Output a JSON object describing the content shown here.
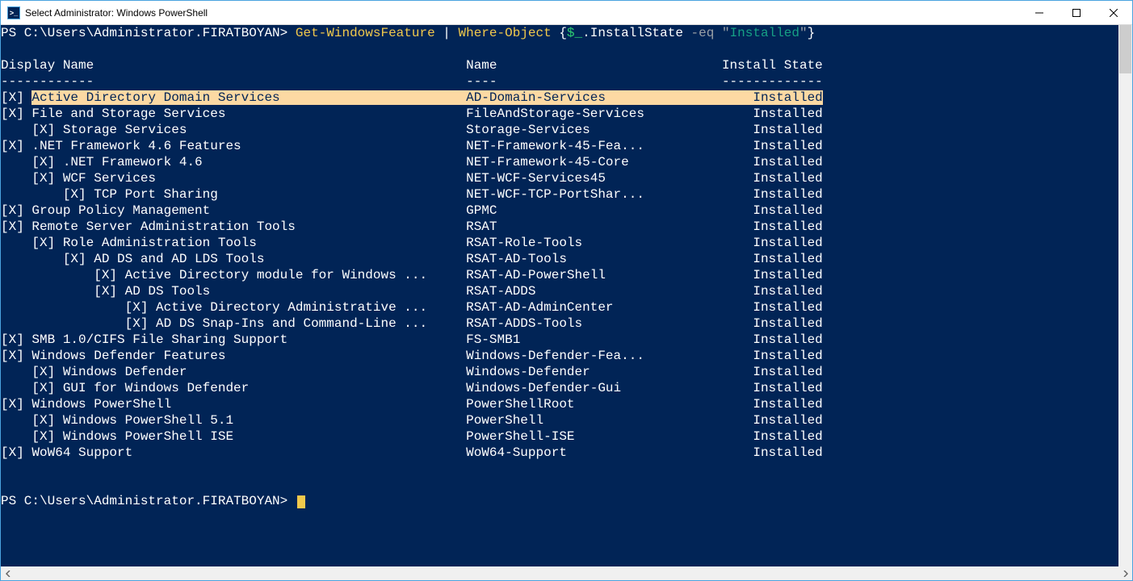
{
  "window": {
    "title": "Select Administrator: Windows PowerShell"
  },
  "prompt": {
    "prefix": "PS ",
    "path": "C:\\Users\\Administrator.FIRATBOYAN>",
    "cmd_part1": "Get-WindowsFeature",
    "pipe": " | ",
    "cmd_part2": "Where-Object",
    "brace_open": " {",
    "var": "$_",
    "member": ".InstallState ",
    "op": "-eq",
    "space": " ",
    "quote_open": "\"",
    "str": "Installed",
    "quote_close": "\"",
    "brace_close": "}"
  },
  "headers": {
    "display": "Display Name",
    "name": "Name",
    "state": "Install State",
    "dash1": "------------",
    "dash2": "----",
    "dash3": "-------------"
  },
  "rows": [
    {
      "indent": 0,
      "mark": "[X]",
      "display": "Active Directory Domain Services",
      "name": "AD-Domain-Services",
      "state": "Installed",
      "selected": true
    },
    {
      "indent": 0,
      "mark": "[X]",
      "display": "File and Storage Services",
      "name": "FileAndStorage-Services",
      "state": "Installed"
    },
    {
      "indent": 1,
      "mark": "[X]",
      "display": "Storage Services",
      "name": "Storage-Services",
      "state": "Installed"
    },
    {
      "indent": 0,
      "mark": "[X]",
      "display": ".NET Framework 4.6 Features",
      "name": "NET-Framework-45-Fea...",
      "state": "Installed"
    },
    {
      "indent": 1,
      "mark": "[X]",
      "display": ".NET Framework 4.6",
      "name": "NET-Framework-45-Core",
      "state": "Installed"
    },
    {
      "indent": 1,
      "mark": "[X]",
      "display": "WCF Services",
      "name": "NET-WCF-Services45",
      "state": "Installed"
    },
    {
      "indent": 2,
      "mark": "[X]",
      "display": "TCP Port Sharing",
      "name": "NET-WCF-TCP-PortShar...",
      "state": "Installed"
    },
    {
      "indent": 0,
      "mark": "[X]",
      "display": "Group Policy Management",
      "name": "GPMC",
      "state": "Installed"
    },
    {
      "indent": 0,
      "mark": "[X]",
      "display": "Remote Server Administration Tools",
      "name": "RSAT",
      "state": "Installed"
    },
    {
      "indent": 1,
      "mark": "[X]",
      "display": "Role Administration Tools",
      "name": "RSAT-Role-Tools",
      "state": "Installed"
    },
    {
      "indent": 2,
      "mark": "[X]",
      "display": "AD DS and AD LDS Tools",
      "name": "RSAT-AD-Tools",
      "state": "Installed"
    },
    {
      "indent": 3,
      "mark": "[X]",
      "display": "Active Directory module for Windows ...",
      "name": "RSAT-AD-PowerShell",
      "state": "Installed"
    },
    {
      "indent": 3,
      "mark": "[X]",
      "display": "AD DS Tools",
      "name": "RSAT-ADDS",
      "state": "Installed"
    },
    {
      "indent": 4,
      "mark": "[X]",
      "display": "Active Directory Administrative ...",
      "name": "RSAT-AD-AdminCenter",
      "state": "Installed"
    },
    {
      "indent": 4,
      "mark": "[X]",
      "display": "AD DS Snap-Ins and Command-Line ...",
      "name": "RSAT-ADDS-Tools",
      "state": "Installed"
    },
    {
      "indent": 0,
      "mark": "[X]",
      "display": "SMB 1.0/CIFS File Sharing Support",
      "name": "FS-SMB1",
      "state": "Installed"
    },
    {
      "indent": 0,
      "mark": "[X]",
      "display": "Windows Defender Features",
      "name": "Windows-Defender-Fea...",
      "state": "Installed"
    },
    {
      "indent": 1,
      "mark": "[X]",
      "display": "Windows Defender",
      "name": "Windows-Defender",
      "state": "Installed"
    },
    {
      "indent": 1,
      "mark": "[X]",
      "display": "GUI for Windows Defender",
      "name": "Windows-Defender-Gui",
      "state": "Installed"
    },
    {
      "indent": 0,
      "mark": "[X]",
      "display": "Windows PowerShell",
      "name": "PowerShellRoot",
      "state": "Installed"
    },
    {
      "indent": 1,
      "mark": "[X]",
      "display": "Windows PowerShell 5.1",
      "name": "PowerShell",
      "state": "Installed"
    },
    {
      "indent": 1,
      "mark": "[X]",
      "display": "Windows PowerShell ISE",
      "name": "PowerShell-ISE",
      "state": "Installed"
    },
    {
      "indent": 0,
      "mark": "[X]",
      "display": "WoW64 Support",
      "name": "WoW64-Support",
      "state": "Installed"
    }
  ],
  "prompt2": {
    "prefix": "PS ",
    "path": "C:\\Users\\Administrator.FIRATBOYAN>"
  },
  "layout": {
    "col_name": 60,
    "col_state": 93,
    "state_width": 13
  }
}
